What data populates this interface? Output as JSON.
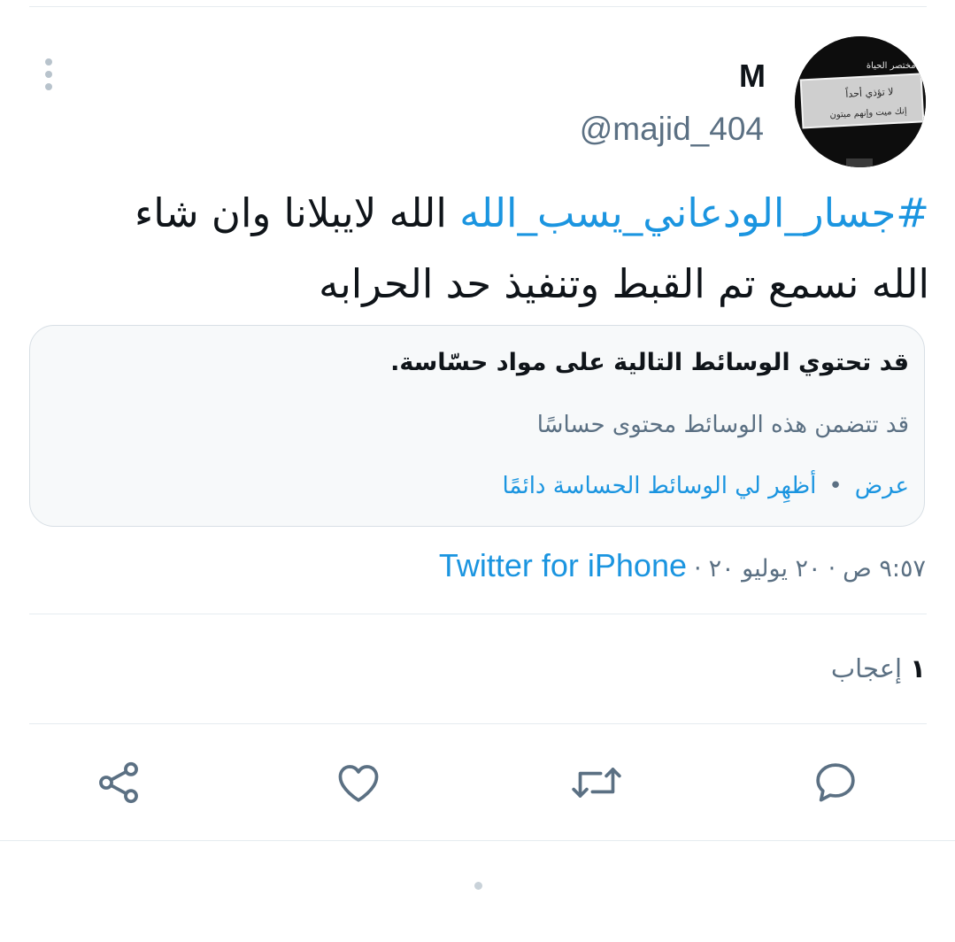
{
  "author": {
    "name": "M",
    "handle": "@majid_404",
    "avatar_caption": "مختصر الحياة:",
    "avatar_line1": "لا تؤذي أحداً",
    "avatar_line2": "إنك ميت وإنهم ميتون"
  },
  "tweet": {
    "hashtag": "#جسار_الودعاني_يسب_الله",
    "text": " الله لايبلانا وان شاء الله نسمع تم القبط وتنفيذ حد الحرابه"
  },
  "sensitive_warning": {
    "title": "قد تحتوي الوسائط التالية على مواد حسّاسة.",
    "description": "قد تتضمن هذه الوسائط محتوى حساسًا",
    "view_label": "عرض",
    "separator": "•",
    "always_show_label": "أظهِر لي الوسائط الحساسة دائمًا"
  },
  "meta": {
    "time": "٩:٥٧ ص",
    "date": "٢٠ يوليو ٢٠",
    "separator": "·",
    "source": "Twitter for iPhone"
  },
  "engagement": {
    "likes_count": "١",
    "likes_label": "إعجاب"
  },
  "actions": {
    "icons": [
      "reply-icon",
      "retweet-icon",
      "like-icon",
      "share-icon"
    ],
    "icon_color": "#5b7083"
  },
  "colors": {
    "accent": "#1b95e0",
    "secondary_text": "#5b7083",
    "primary_text": "#0f1419"
  }
}
